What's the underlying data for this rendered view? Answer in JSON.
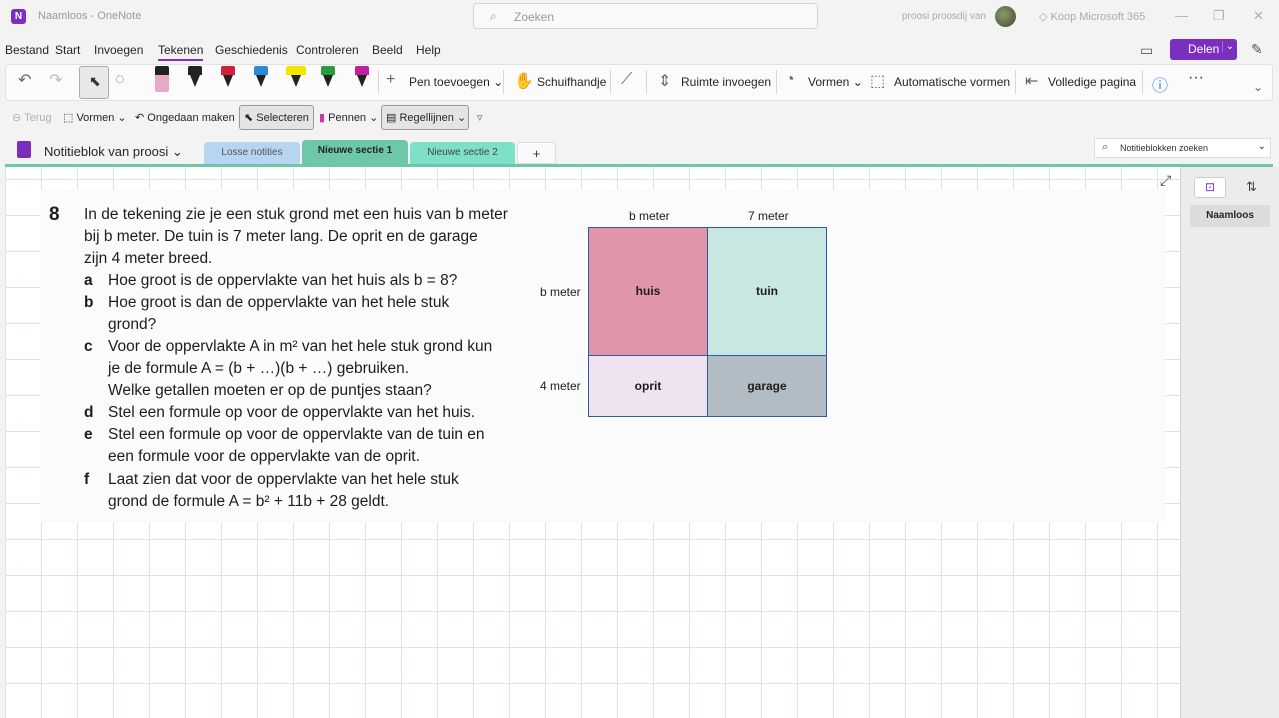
{
  "window": {
    "app_icon_letter": "N",
    "title": "Naamloos - OneNote",
    "search_placeholder": "Zoeken",
    "user": "proosi proosdij van",
    "buy": "Koop Microsoft 365"
  },
  "menu": {
    "items": [
      "Bestand",
      "Start",
      "Invoegen",
      "Tekenen",
      "Geschiedenis",
      "Controleren",
      "Beeld",
      "Help"
    ],
    "active": "Tekenen",
    "share_label": "Delen"
  },
  "ribbon": {
    "add_pen": "Pen toevoegen",
    "pan_hand": "Schuifhandje",
    "insert_space": "Ruimte invoegen",
    "shapes": "Vormen",
    "auto_shapes": "Automatische vormen",
    "full_page": "Volledige pagina",
    "pen_colors": [
      "#e8a8c8",
      "#222222",
      "#d0203a",
      "#2a8ad8",
      "#f2e600",
      "#2a9a3a",
      "#c020a0"
    ]
  },
  "ribbon2": {
    "back": "Terug",
    "shapes": "Vormen",
    "undo": "Ongedaan maken",
    "select": "Selecteren",
    "pens": "Pennen",
    "rule_lines": "Regellijnen"
  },
  "notebook": {
    "name": "Notitieblok van proosi",
    "tabs": [
      {
        "label": "Losse notities",
        "color": "#b7d4f0"
      },
      {
        "label": "Nieuwe sectie 1",
        "color": "#6cc8a8"
      },
      {
        "label": "Nieuwe sectie 2",
        "color": "#7fe0c8"
      }
    ],
    "add_tab": "+",
    "search_placeholder": "Notitieblokken zoeken"
  },
  "exercise": {
    "number": "8",
    "intro": [
      "In de tekening zie je een stuk grond met een huis van b meter",
      "bij b meter. De tuin is 7 meter lang. De oprit en de garage",
      "zijn 4 meter breed."
    ],
    "questions": [
      {
        "letter": "a",
        "lines": [
          "Hoe groot is de oppervlakte van het huis als b = 8?"
        ]
      },
      {
        "letter": "b",
        "lines": [
          "Hoe groot is dan de oppervlakte van het hele stuk",
          "grond?"
        ]
      },
      {
        "letter": "c",
        "lines": [
          "Voor de oppervlakte A in m² van het hele stuk grond kun",
          "je de formule A = (b + …)(b + …) gebruiken.",
          "Welke getallen moeten er op de puntjes staan?"
        ]
      },
      {
        "letter": "d",
        "lines": [
          "Stel een formule op voor de oppervlakte van het huis."
        ]
      },
      {
        "letter": "e",
        "lines": [
          "Stel een formule op voor de oppervlakte van de tuin en",
          "een formule voor de oppervlakte van de oprit."
        ]
      },
      {
        "letter": "f",
        "lines": [
          "Laat zien dat voor de oppervlakte van het hele stuk",
          "grond de formule A = b² + 11b + 28 geldt."
        ]
      }
    ]
  },
  "diagram": {
    "col_labels": [
      "b meter",
      "7 meter"
    ],
    "row_labels": [
      "b meter",
      "4 meter"
    ],
    "cells": [
      {
        "label": "huis",
        "color": "#e195a8"
      },
      {
        "label": "tuin",
        "color": "#c8e6e2"
      },
      {
        "label": "oprit",
        "color": "#efe3f2"
      },
      {
        "label": "garage",
        "color": "#b2bcc4"
      }
    ]
  },
  "pages": {
    "items": [
      "Naamloos"
    ]
  }
}
